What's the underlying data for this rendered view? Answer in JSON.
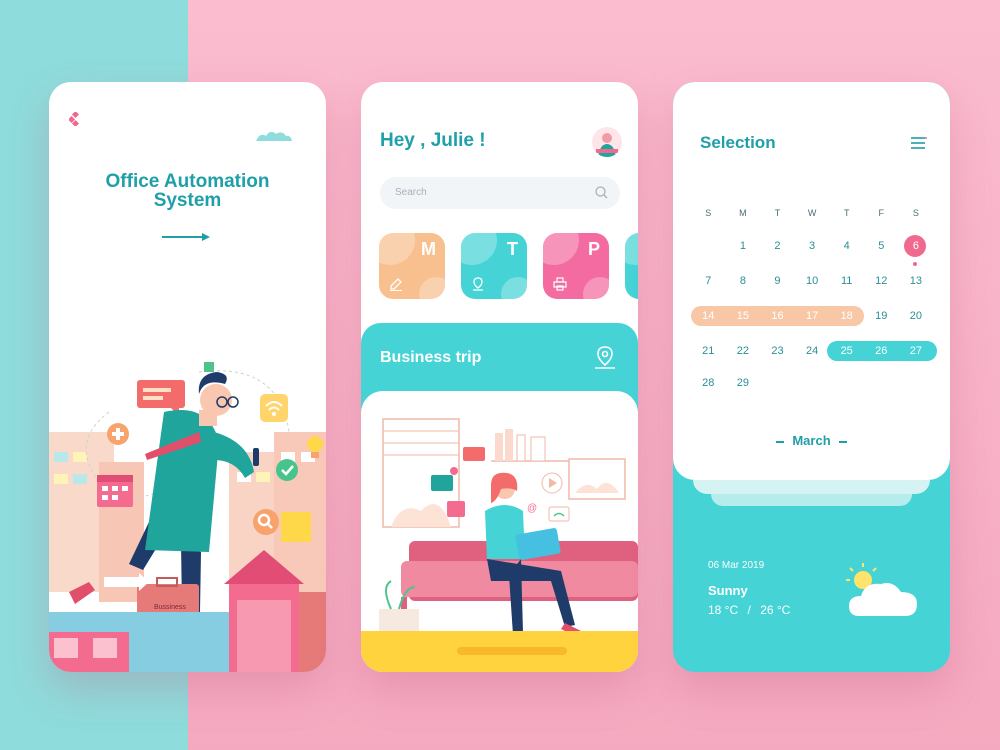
{
  "colors": {
    "teal": "#46d3d6",
    "teal_dark": "#1f9fa8",
    "pink": "#f06a8f",
    "orange": "#f8c7a6",
    "bg_pink": "#f7b8cb",
    "bg_mint": "#8fdcdc"
  },
  "splash": {
    "title_line1": "Office Automation",
    "title_line2": "System",
    "briefcase_label": "Bussiness",
    "icons": [
      "logo-icon",
      "arrow-right-icon",
      "cloud-icon",
      "plus-icon",
      "check-icon",
      "search-icon",
      "wifi-icon",
      "bulb-icon",
      "calendar-icon",
      "chat-icon"
    ]
  },
  "home": {
    "greeting": "Hey , Julie !",
    "search_placeholder": "Search",
    "tiles": [
      {
        "letter": "M",
        "color": "#f8c08f",
        "icon": "edit-icon"
      },
      {
        "letter": "T",
        "color": "#46d3d6",
        "icon": "location-icon"
      },
      {
        "letter": "P",
        "color": "#f36ba0",
        "icon": "printer-icon"
      },
      {
        "letter": "",
        "color": "#46d3d6",
        "icon": ""
      }
    ],
    "section_title": "Business trip",
    "section_icon": "location-pin-icon"
  },
  "calendar": {
    "title": "Selection",
    "weekdays": [
      "S",
      "M",
      "T",
      "W",
      "T",
      "F",
      "S"
    ],
    "weeks": [
      [
        "",
        "1",
        "2",
        "3",
        "4",
        "5",
        "6"
      ],
      [
        "7",
        "8",
        "9",
        "10",
        "11",
        "12",
        "13"
      ],
      [
        "14",
        "15",
        "16",
        "17",
        "18",
        "19",
        "20"
      ],
      [
        "21",
        "22",
        "23",
        "24",
        "25",
        "26",
        "27"
      ],
      [
        "28",
        "29",
        "",
        "",
        "",
        "",
        ""
      ]
    ],
    "selected_day": "6",
    "range_orange": [
      "14",
      "18"
    ],
    "range_teal": [
      "25",
      "27"
    ],
    "month": "March"
  },
  "weather": {
    "date": "06 Mar 2019",
    "condition": "Sunny",
    "temp_low": "18 °C",
    "separator": "/",
    "temp_high": "26 °C",
    "icon": "partly-cloudy-icon"
  }
}
